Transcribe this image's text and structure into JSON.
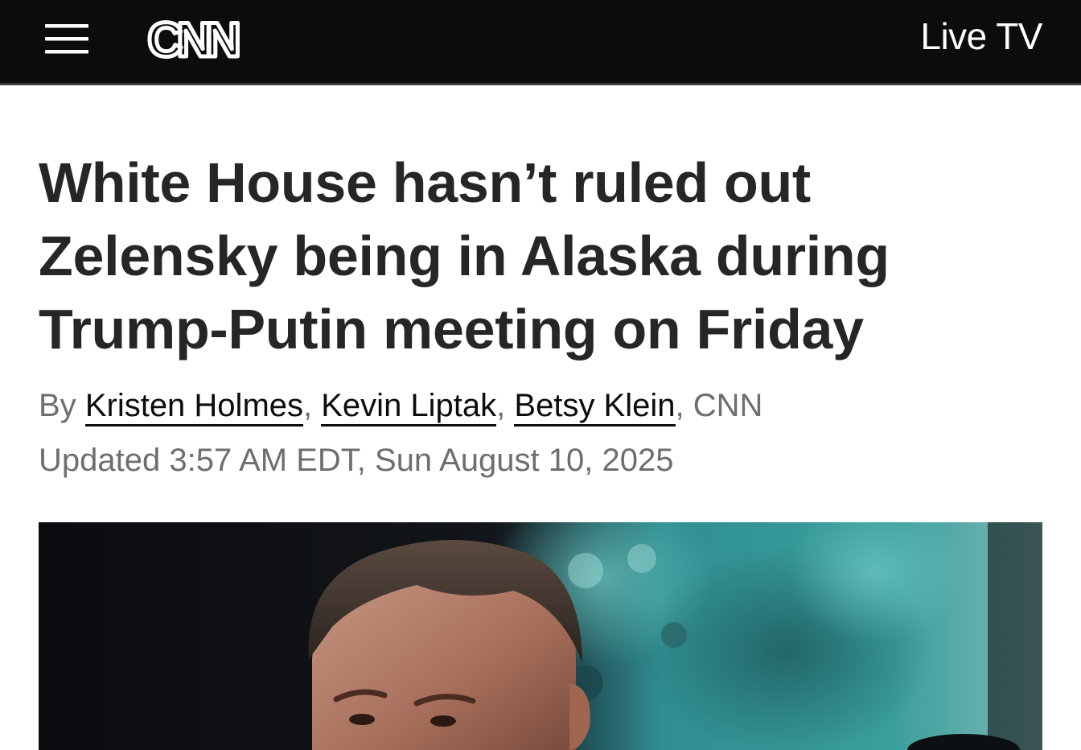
{
  "header": {
    "menu_icon": "hamburger-menu-icon",
    "logo_text": "CNN",
    "live_tv_label": "Live TV",
    "background_color": "#0c0c0c"
  },
  "article": {
    "headline": "White House hasn’t ruled out Zelensky being in Alaska during Trump-Putin meeting on Friday",
    "byline": {
      "prefix": "By",
      "authors": [
        "Kristen Holmes",
        "Kevin Liptak",
        "Betsy Klein"
      ],
      "outlet": "CNN"
    },
    "timestamp": "Updated 3:57 AM EDT, Sun August 10, 2025",
    "hero_image": {
      "icon": "photo-icon"
    }
  }
}
